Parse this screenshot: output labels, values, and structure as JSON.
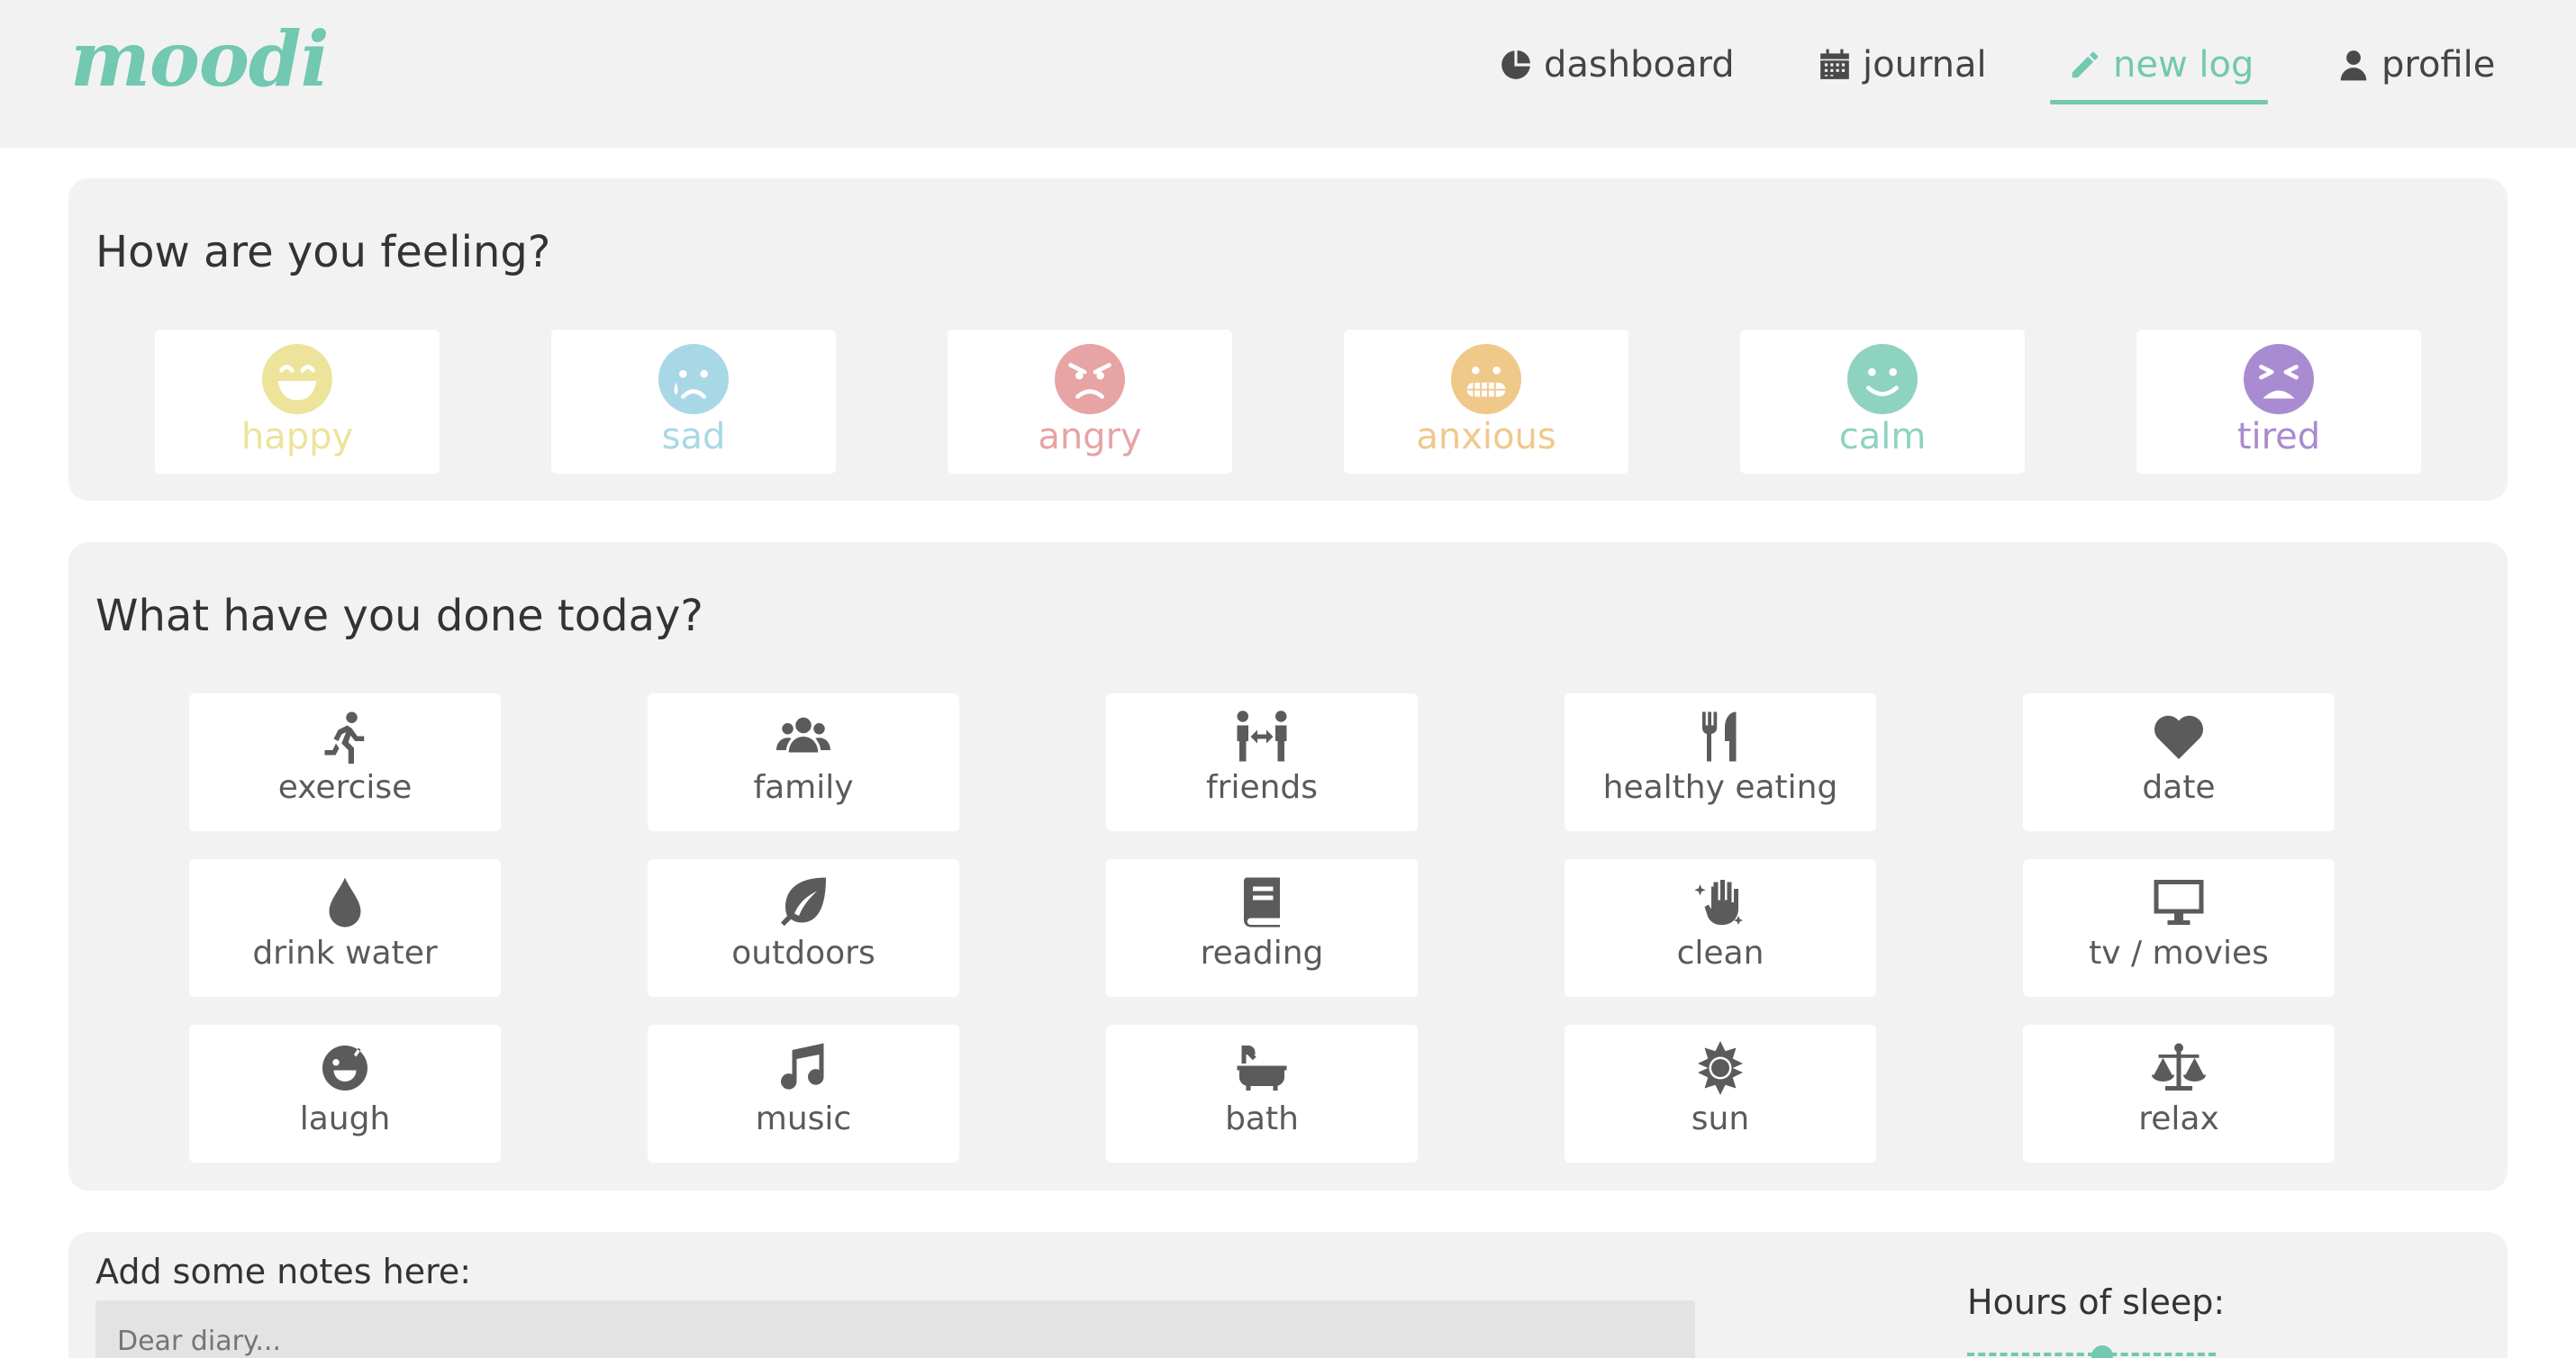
{
  "app": {
    "logo": "moodi"
  },
  "nav": [
    {
      "label": "dashboard",
      "icon": "pie-chart-icon"
    },
    {
      "label": "journal",
      "icon": "calendar-icon"
    },
    {
      "label": "new log",
      "icon": "pencil-icon",
      "active": true
    },
    {
      "label": "profile",
      "icon": "user-icon"
    }
  ],
  "colors": {
    "accent": "#72c8b0",
    "happy": "#ede39b",
    "sad": "#a8d8e6",
    "angry": "#e6a4a4",
    "anxious": "#efc98a",
    "calm": "#8dd3c0",
    "tired": "#a98bd1"
  },
  "mood_section": {
    "title": "How are you feeling?",
    "moods": [
      {
        "label": "happy",
        "icon": "grin-face-icon"
      },
      {
        "label": "sad",
        "icon": "crying-face-icon"
      },
      {
        "label": "angry",
        "icon": "angry-face-icon"
      },
      {
        "label": "anxious",
        "icon": "grimace-face-icon"
      },
      {
        "label": "calm",
        "icon": "smile-face-icon"
      },
      {
        "label": "tired",
        "icon": "tired-face-icon"
      }
    ]
  },
  "activity_section": {
    "title": "What have you done today?",
    "activities": [
      {
        "label": "exercise",
        "icon": "running-icon"
      },
      {
        "label": "family",
        "icon": "users-icon"
      },
      {
        "label": "friends",
        "icon": "people-arrows-icon"
      },
      {
        "label": "healthy eating",
        "icon": "utensils-icon"
      },
      {
        "label": "date",
        "icon": "heart-icon"
      },
      {
        "label": "drink water",
        "icon": "water-drop-icon"
      },
      {
        "label": "outdoors",
        "icon": "leaf-icon"
      },
      {
        "label": "reading",
        "icon": "book-icon"
      },
      {
        "label": "clean",
        "icon": "sparkle-hand-icon"
      },
      {
        "label": "tv / movies",
        "icon": "monitor-icon"
      },
      {
        "label": "laugh",
        "icon": "laugh-face-icon"
      },
      {
        "label": "music",
        "icon": "music-note-icon"
      },
      {
        "label": "bath",
        "icon": "bath-icon"
      },
      {
        "label": "sun",
        "icon": "sun-icon"
      },
      {
        "label": "relax",
        "icon": "balance-scale-icon"
      }
    ]
  },
  "notes": {
    "label": "Add some notes here:",
    "placeholder": "Dear diary..."
  },
  "sleep": {
    "label": "Hours of sleep:",
    "value_fraction": 0.5
  }
}
